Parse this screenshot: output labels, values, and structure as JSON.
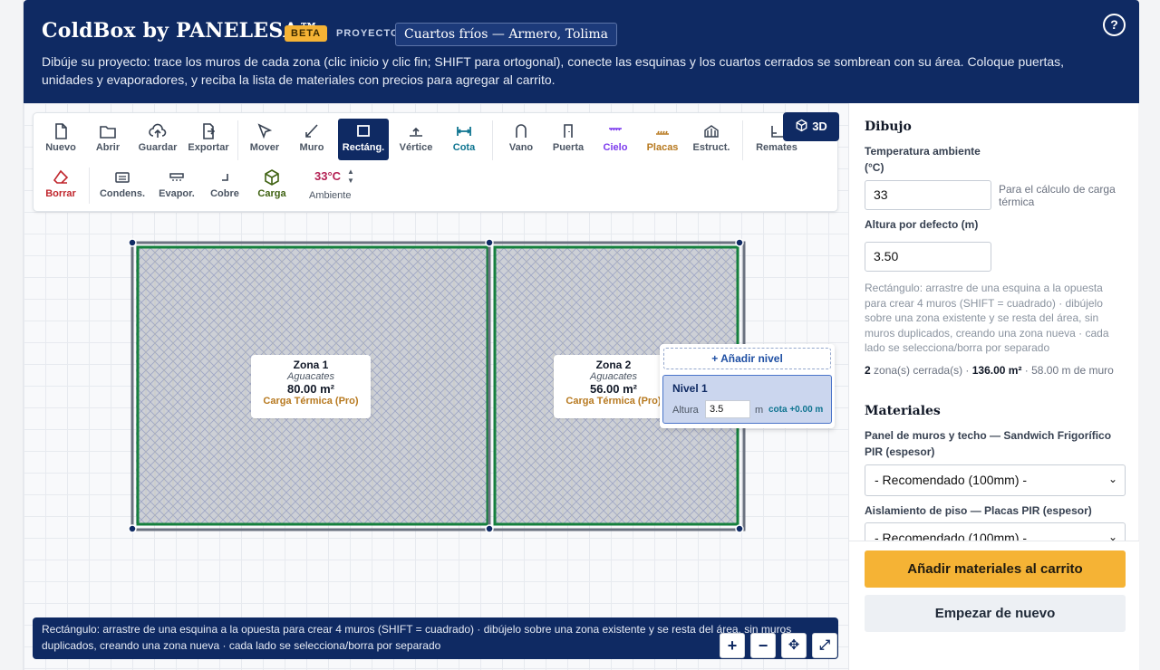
{
  "header": {
    "brand": "ColdBox by PANELESA™",
    "badge": "BETA",
    "project_label": "PROYECTO",
    "project_name": "Cuartos fríos — Armero, Tolima",
    "help": "?",
    "description": "Dibúje su proyecto: trace los muros de cada zona (clic inicio y clic fin; SHIFT para ortogonal), conecte las esquinas y los cuartos cerrados se sombrean con su área. Coloque puertas, unidades y evaporadores, y reciba la lista de materiales con precios para agregar al carrito."
  },
  "toolbar": {
    "row1": [
      {
        "label": "Nuevo",
        "icon": "file-icon"
      },
      {
        "label": "Abrir",
        "icon": "folder-icon"
      },
      {
        "label": "Guardar",
        "icon": "cloud-upload-icon"
      },
      {
        "label": "Exportar",
        "icon": "export-icon"
      },
      {
        "label": "Mover",
        "icon": "cursor-icon"
      },
      {
        "label": "Muro",
        "icon": "wall-line-icon"
      },
      {
        "label": "Rectáng.",
        "icon": "rectangle-icon",
        "active": true
      },
      {
        "label": "Vértice",
        "icon": "vertex-icon"
      },
      {
        "label": "Cota",
        "icon": "dimension-icon"
      },
      {
        "label": "Vano",
        "icon": "opening-icon"
      },
      {
        "label": "Puerta",
        "icon": "door-icon"
      },
      {
        "label": "Cielo",
        "icon": "ceiling-icon"
      },
      {
        "label": "Placas",
        "icon": "plates-icon"
      },
      {
        "label": "Estruct.",
        "icon": "structure-icon"
      },
      {
        "label": "Remates",
        "icon": "trim-icon"
      }
    ],
    "row2": [
      {
        "label": "Borrar",
        "icon": "eraser-icon"
      },
      {
        "label": "Condens.",
        "icon": "condenser-icon"
      },
      {
        "label": "Evapor.",
        "icon": "evaporator-icon"
      },
      {
        "label": "Cobre",
        "icon": "copper-pipe-icon"
      },
      {
        "label": "Carga",
        "icon": "cargo-box-icon"
      }
    ],
    "ambient_value": "33°C",
    "ambient_label": "Ambiente",
    "view3d": "3D",
    "colors": {
      "active": "#0f2a63",
      "borrar": "#c0262d",
      "cota": "#0e7490",
      "cielo": "#7c3aed",
      "placas": "#b7791f",
      "carga": "#3f6212"
    }
  },
  "zones": [
    {
      "name": "Zona 1",
      "product": "Aguacates",
      "area": "80.00 m²",
      "load": "Carga Térmica (Pro)"
    },
    {
      "name": "Zona 2",
      "product": "Aguacates",
      "area": "56.00 m²",
      "load": "Carga Térmica (Pro)"
    }
  ],
  "levels": {
    "add": "+ Añadir nivel",
    "items": [
      {
        "name": "Nivel 1",
        "height_label": "Altura",
        "height": "3.5",
        "unit": "m",
        "cota": "cota +0.00 m"
      }
    ]
  },
  "status_text": "Rectángulo: arrastre de una esquina a la opuesta para crear 4 muros (SHIFT = cuadrado) · dibújelo sobre una zona existente y se resta del área, sin muros duplicados, creando una zona nueva · cada lado se selecciona/borra por separado",
  "zoom": {
    "in": "+",
    "out": "−",
    "pan": "✥",
    "fit": "⤢"
  },
  "panel": {
    "drawing_title": "Dibujo",
    "temp_label_line1": "Temperatura ambiente",
    "temp_label_line2": "(°C)",
    "temp_value": "33",
    "temp_hint": "Para el cálculo de carga térmica",
    "height_label": "Altura por defecto (m)",
    "height_value": "3.50",
    "help_text": "Rectángulo: arrastre de una esquina a la opuesta para crear 4 muros (SHIFT = cuadrado) · dibújelo sobre una zona existente y se resta del área, sin muros duplicados, creando una zona nueva · cada lado se selecciona/borra por separado",
    "stats": {
      "zones": "2",
      "zones_text": "zona(s) cerrada(s) ·",
      "area": "136.00 m²",
      "walls": "· 58.00 m de muro"
    },
    "materials_title": "Materiales",
    "wall_panel_label": "Panel de muros y techo — Sandwich Frigorífico PIR (espesor)",
    "wall_panel_value": "- Recomendado (100mm) -",
    "floor_label": "Aislamiento de piso — Placas PIR (espesor)",
    "floor_value": "- Recomendado (100mm) -",
    "add_to_cart": "Añadir materiales al carrito",
    "reset": "Empezar de nuevo"
  }
}
